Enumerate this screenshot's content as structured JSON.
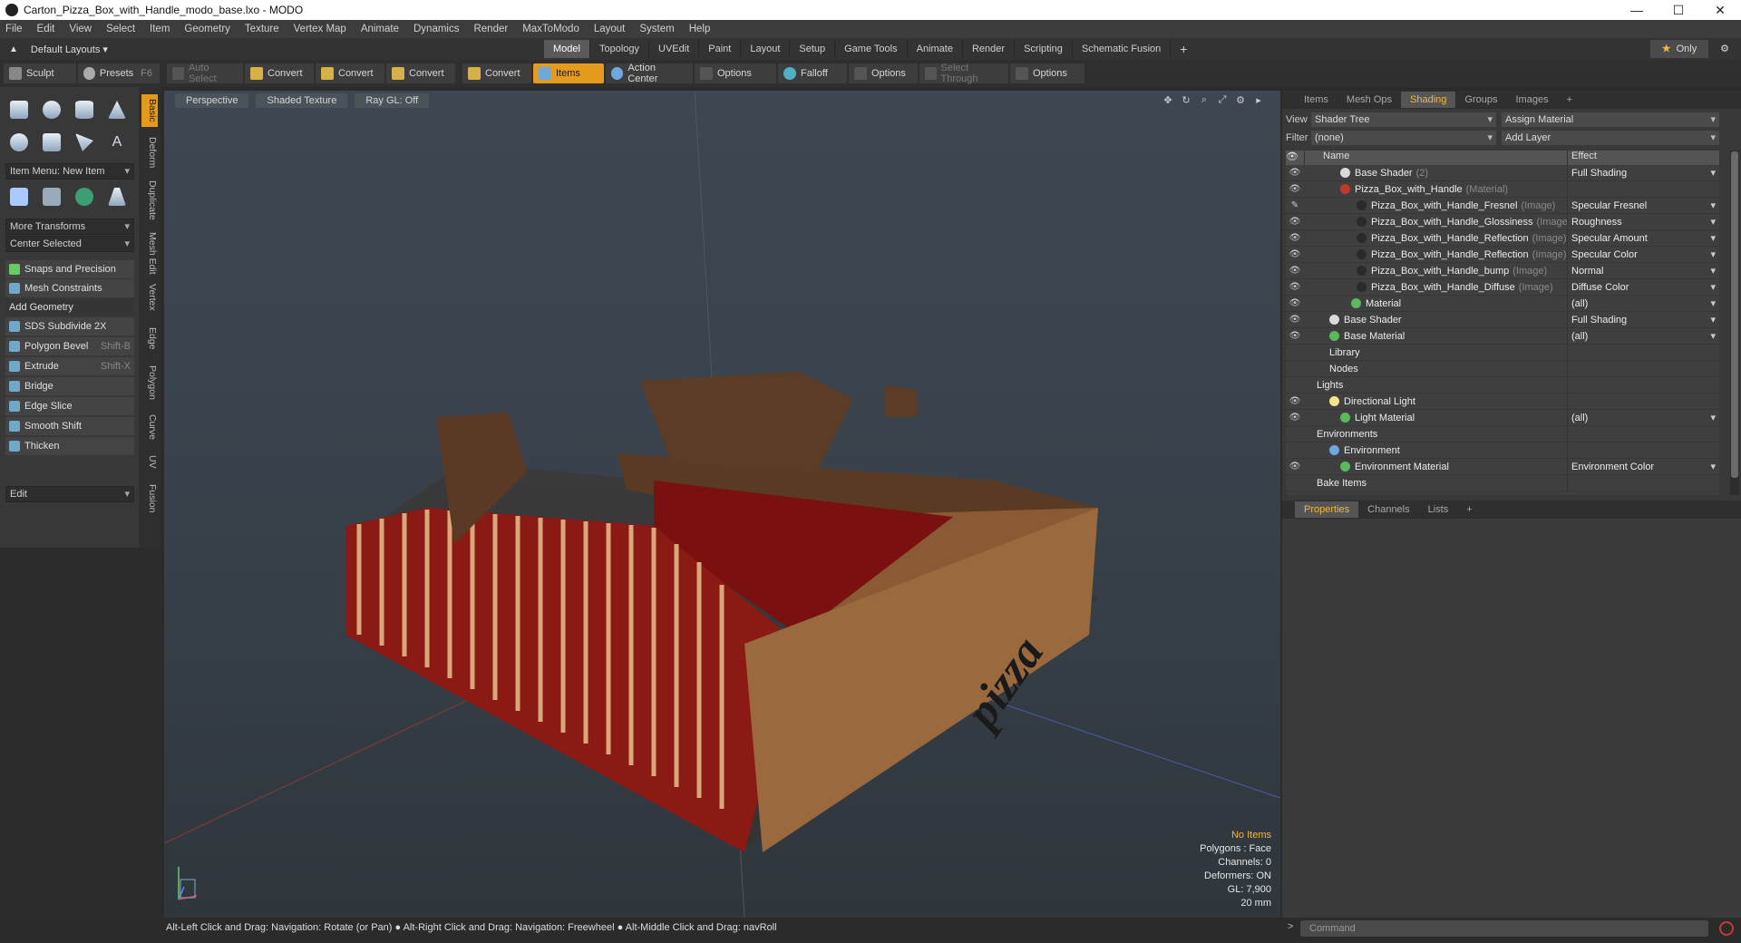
{
  "window": {
    "title": "Carton_Pizza_Box_with_Handle_modo_base.lxo - MODO"
  },
  "menu": [
    "File",
    "Edit",
    "View",
    "Select",
    "Item",
    "Geometry",
    "Texture",
    "Vertex Map",
    "Animate",
    "Dynamics",
    "Render",
    "MaxToModo",
    "Layout",
    "System",
    "Help"
  ],
  "layout": {
    "label": "Default Layouts ▾"
  },
  "tabs": [
    "Model",
    "Topology",
    "UVEdit",
    "Paint",
    "Layout",
    "Setup",
    "Game Tools",
    "Animate",
    "Render",
    "Scripting",
    "Schematic Fusion",
    "+"
  ],
  "only_label": "Only",
  "toolbar": {
    "sculpt": "Sculpt",
    "presets": "Presets",
    "presets_key": "F6",
    "auto_select": "Auto Select",
    "convert1": "Convert",
    "convert2": "Convert",
    "convert3": "Convert",
    "convert4": "Convert",
    "items": "Items",
    "action_center": "Action Center",
    "options1": "Options",
    "falloff": "Falloff",
    "options2": "Options",
    "select_through": "Select Through",
    "options3": "Options"
  },
  "left": {
    "item_menu": "Item Menu: New Item",
    "more_transforms": "More Transforms",
    "center_selected": "Center Selected",
    "snaps": "Snaps and Precision",
    "mesh_constraints": "Mesh Constraints",
    "add_geometry": "Add Geometry",
    "tools": [
      {
        "label": "SDS Subdivide 2X",
        "key": ""
      },
      {
        "label": "Polygon Bevel",
        "key": "Shift-B"
      },
      {
        "label": "Extrude",
        "key": "Shift-X"
      },
      {
        "label": "Bridge",
        "key": ""
      },
      {
        "label": "Edge Slice",
        "key": ""
      },
      {
        "label": "Smooth Shift",
        "key": ""
      },
      {
        "label": "Thicken",
        "key": ""
      }
    ],
    "edit": "Edit",
    "vtabs": [
      "Basic",
      "Deform",
      "Duplicate",
      "Mesh Edit",
      "Vertex",
      "Edge",
      "Polygon",
      "Curve",
      "UV",
      "Fusion"
    ]
  },
  "viewport": {
    "view_mode": "Perspective",
    "shading": "Shaded Texture",
    "raygl": "Ray GL: Off",
    "hud": {
      "items": "No Items",
      "polygons": "Polygons : Face",
      "channels": "Channels: 0",
      "deformers": "Deformers: ON",
      "gl": "GL: 7,900",
      "scale": "20 mm"
    },
    "box_text": "pizza"
  },
  "status": "Alt-Left Click and Drag: Navigation: Rotate (or Pan) ● Alt-Right Click and Drag: Navigation: Freewheel ● Alt-Middle Click and Drag: navRoll",
  "right": {
    "tabs": [
      "Items",
      "Mesh Ops",
      "Shading",
      "Groups",
      "Images",
      "+"
    ],
    "view_label": "View",
    "view_value": "Shader Tree",
    "assign_material": "Assign Material",
    "filter_label": "Filter",
    "filter_value": "(none)",
    "add_layer": "Add Layer",
    "col_name": "Name",
    "col_effect": "Effect",
    "rows": [
      {
        "name": "Base Shader",
        "tag": "(2)",
        "effect": "Full Shading",
        "eye": "👁",
        "indent": 40,
        "color": "#d9d9d9"
      },
      {
        "name": "Pizza_Box_with_Handle",
        "tag": "(Material)",
        "effect": "",
        "eye": "👁",
        "indent": 40,
        "color": "#c0392b"
      },
      {
        "name": "Pizza_Box_with_Handle_Fresnel",
        "tag": "(Image)",
        "effect": "Specular Fresnel",
        "eye": "✎",
        "indent": 58,
        "color": "#2a2a2a"
      },
      {
        "name": "Pizza_Box_with_Handle_Glossiness",
        "tag": "(Image)",
        "effect": "Roughness",
        "eye": "👁",
        "indent": 58,
        "color": "#2a2a2a"
      },
      {
        "name": "Pizza_Box_with_Handle_Reflection",
        "tag": "(Image)",
        "effect": "Specular Amount",
        "eye": "👁",
        "indent": 58,
        "color": "#2a2a2a"
      },
      {
        "name": "Pizza_Box_with_Handle_Reflection",
        "tag": "(Image)",
        "effect": "Specular Color",
        "eye": "👁",
        "indent": 58,
        "color": "#2a2a2a"
      },
      {
        "name": "Pizza_Box_with_Handle_bump",
        "tag": "(Image)",
        "effect": "Normal",
        "eye": "👁",
        "indent": 58,
        "color": "#2a2a2a"
      },
      {
        "name": "Pizza_Box_with_Handle_Diffuse",
        "tag": "(Image)",
        "effect": "Diffuse Color",
        "eye": "👁",
        "indent": 58,
        "color": "#2a2a2a"
      },
      {
        "name": "Material",
        "tag": "",
        "effect": "(all)",
        "eye": "👁",
        "indent": 52,
        "color": "#5cb85c"
      },
      {
        "name": "Base Shader",
        "tag": "",
        "effect": "Full Shading",
        "eye": "👁",
        "indent": 28,
        "color": "#d9d9d9"
      },
      {
        "name": "Base Material",
        "tag": "",
        "effect": "(all)",
        "eye": "👁",
        "indent": 28,
        "color": "#5cb85c"
      },
      {
        "name": "Library",
        "tag": "",
        "effect": "",
        "eye": "",
        "indent": 28,
        "color": ""
      },
      {
        "name": "Nodes",
        "tag": "",
        "effect": "",
        "eye": "",
        "indent": 28,
        "color": ""
      },
      {
        "name": "Lights",
        "tag": "",
        "effect": "",
        "eye": "",
        "indent": 14,
        "color": ""
      },
      {
        "name": "Directional Light",
        "tag": "",
        "effect": "",
        "eye": "👁",
        "indent": 28,
        "color": "#f0e68c"
      },
      {
        "name": "Light Material",
        "tag": "",
        "effect": "(all)",
        "eye": "👁",
        "indent": 40,
        "color": "#5cb85c"
      },
      {
        "name": "Environments",
        "tag": "",
        "effect": "",
        "eye": "",
        "indent": 14,
        "color": ""
      },
      {
        "name": "Environment",
        "tag": "",
        "effect": "",
        "eye": "",
        "indent": 28,
        "color": "#6fa8dc"
      },
      {
        "name": "Environment Material",
        "tag": "",
        "effect": "Environment Color",
        "eye": "👁",
        "indent": 40,
        "color": "#5cb85c"
      },
      {
        "name": "Bake Items",
        "tag": "",
        "effect": "",
        "eye": "",
        "indent": 14,
        "color": ""
      }
    ],
    "props_tabs": [
      "Properties",
      "Channels",
      "Lists",
      "+"
    ],
    "command_placeholder": "Command"
  }
}
